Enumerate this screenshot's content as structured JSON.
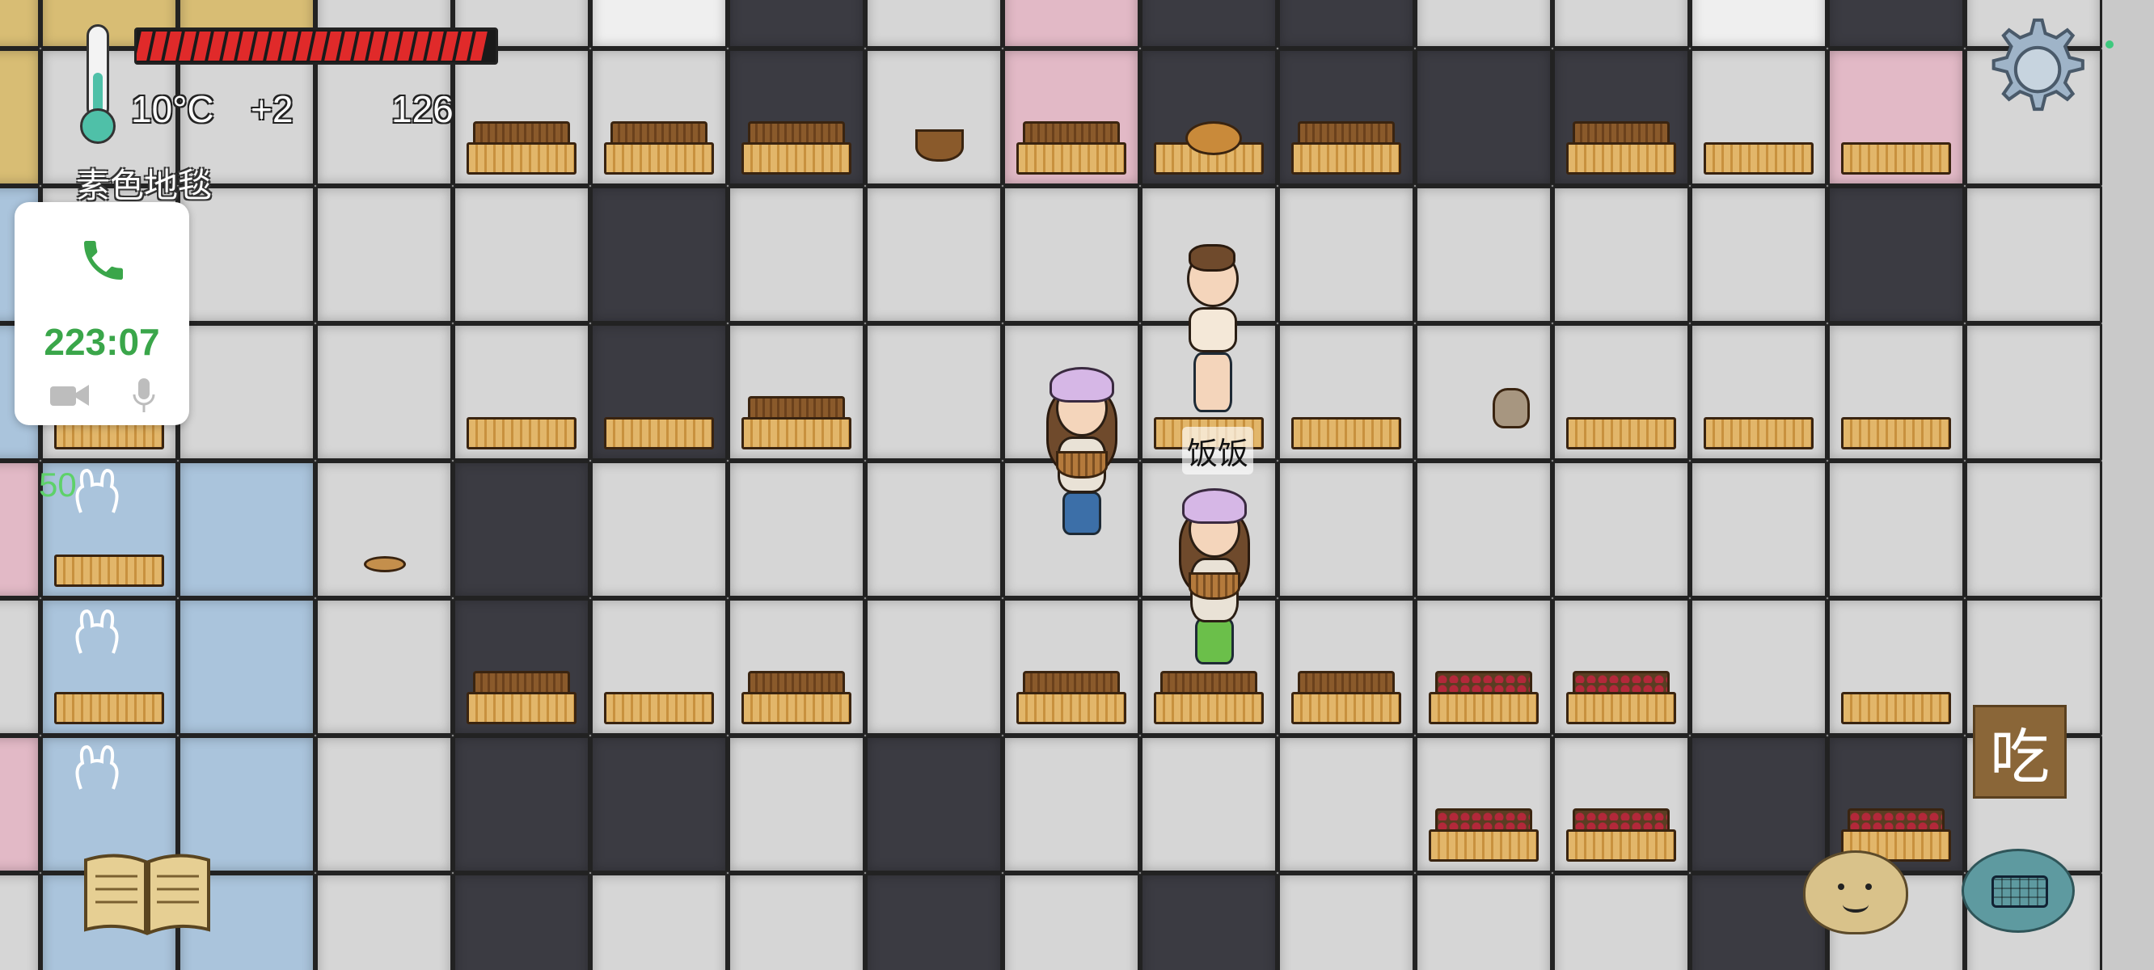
{
  "hud": {
    "temperature": "10°C",
    "temp_delta": "+2",
    "count": "126",
    "hunger_pips": 24,
    "location_label": "素色地毯"
  },
  "call": {
    "duration": "223:07",
    "icons": [
      "phone-icon",
      "video-camera-icon",
      "microphone-icon"
    ],
    "accent_color": "#3aa64a"
  },
  "player_label": "饭饭",
  "side_number": "50",
  "buttons": {
    "eat_label": "吃",
    "settings_icon": "gear-icon",
    "book_icon": "open-book-icon",
    "emote_icon": "potato-face-icon",
    "keyboard_icon": "keyboard-icon"
  },
  "colors": {
    "hunger": "#e02a2a",
    "tile_light": "#d6d6d6",
    "tile_dark": "#3b3b42",
    "tile_pink": "#e2b9c6",
    "tile_blue": "#aac4dc"
  }
}
